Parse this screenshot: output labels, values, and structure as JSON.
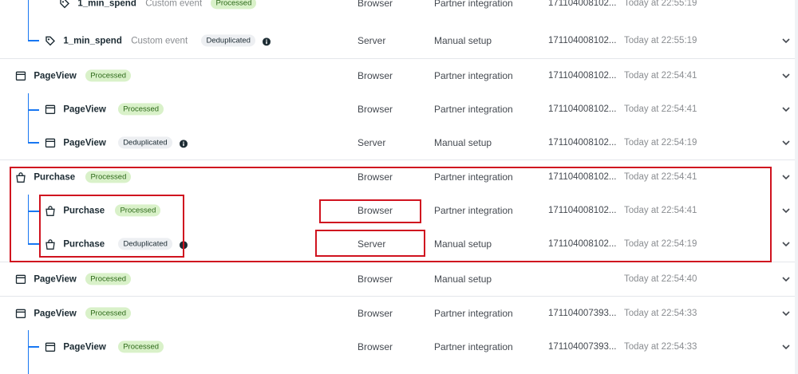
{
  "rows": [
    {
      "name": "1_min_spend",
      "desc": "Custom event",
      "badge": "Processed",
      "source": "Browser",
      "setup": "Partner integration",
      "id": "171104008102...",
      "time": "Today at 22:55:19"
    },
    {
      "name": "1_min_spend",
      "desc": "Custom event",
      "badge": "Deduplicated",
      "source": "Server",
      "setup": "Manual setup",
      "id": "171104008102...",
      "time": "Today at 22:55:19"
    },
    {
      "name": "PageView",
      "badge": "Processed",
      "source": "Browser",
      "setup": "Partner integration",
      "id": "171104008102...",
      "time": "Today at 22:54:41"
    },
    {
      "name": "PageView",
      "badge": "Processed",
      "source": "Browser",
      "setup": "Partner integration",
      "id": "171104008102...",
      "time": "Today at 22:54:41"
    },
    {
      "name": "PageView",
      "badge": "Deduplicated",
      "source": "Server",
      "setup": "Manual setup",
      "id": "171104008102...",
      "time": "Today at 22:54:19"
    },
    {
      "name": "Purchase",
      "badge": "Processed",
      "source": "Browser",
      "setup": "Partner integration",
      "id": "171104008102...",
      "time": "Today at 22:54:41"
    },
    {
      "name": "Purchase",
      "badge": "Processed",
      "source": "Browser",
      "setup": "Partner integration",
      "id": "171104008102...",
      "time": "Today at 22:54:41"
    },
    {
      "name": "Purchase",
      "badge": "Deduplicated",
      "source": "Server",
      "setup": "Manual setup",
      "id": "171104008102...",
      "time": "Today at 22:54:19"
    },
    {
      "name": "PageView",
      "badge": "Processed",
      "source": "Browser",
      "setup": "Manual setup",
      "id": "",
      "time": "Today at 22:54:40"
    },
    {
      "name": "PageView",
      "badge": "Processed",
      "source": "Browser",
      "setup": "Partner integration",
      "id": "171104007393...",
      "time": "Today at 22:54:33"
    },
    {
      "name": "PageView",
      "badge": "Processed",
      "source": "Browser",
      "setup": "Partner integration",
      "id": "171104007393...",
      "time": "Today at 22:54:33"
    }
  ],
  "colors": {
    "accent": "#1877f2",
    "processed_bg": "#d9f1c9",
    "highlight": "#d0131f"
  },
  "icons": {
    "custom": "tag-icon",
    "page": "browser-window-icon",
    "purchase": "shopping-bag-icon",
    "info": "info-icon",
    "expand": "chevron-down-icon"
  }
}
